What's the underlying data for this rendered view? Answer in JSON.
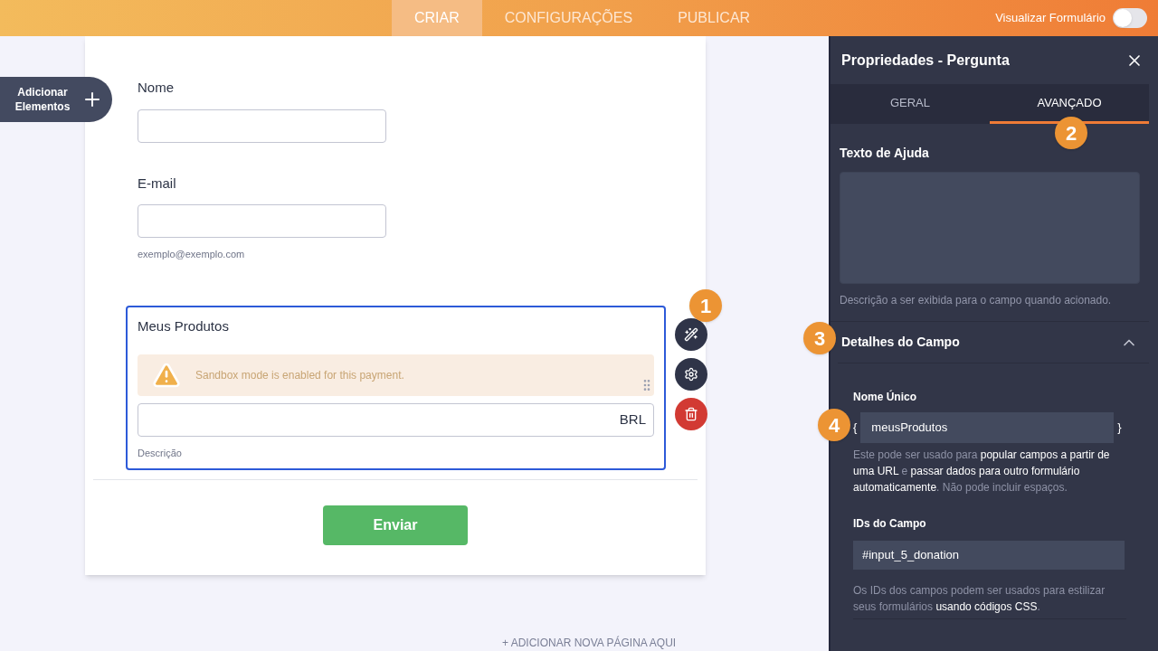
{
  "header": {
    "tabs": [
      {
        "label": "CRIAR",
        "selected": true
      },
      {
        "label": "CONFIGURAÇÕES",
        "selected": false
      },
      {
        "label": "PUBLICAR",
        "selected": false
      }
    ],
    "preview": {
      "label": "Visualizar Formulário",
      "on": false
    }
  },
  "add_elements": {
    "label": "Adicionar Elementos"
  },
  "form": {
    "fields": [
      {
        "kind": "text",
        "label": "Nome",
        "selected": false
      },
      {
        "kind": "email",
        "label": "E-mail",
        "hint": "exemplo@exemplo.com",
        "selected": false
      },
      {
        "kind": "payment",
        "label": "Meus Produtos",
        "warning": "Sandbox mode is enabled for this payment.",
        "currency": "BRL",
        "hint": "Descrição",
        "selected": true
      }
    ],
    "submit": "Enviar"
  },
  "add_page": "+ ADICIONAR NOVA PÁGINA AQUI",
  "panel": {
    "title": "Propriedades - Pergunta",
    "tabs": [
      {
        "label": "GERAL",
        "selected": false
      },
      {
        "label": "AVANÇADO",
        "selected": true
      }
    ],
    "help_text": {
      "label": "Texto de Ajuda",
      "note": "Descrição a ser exibida para o campo quando acionado."
    },
    "section": {
      "title": "Detalhes do Campo",
      "expanded": true,
      "unique_name": {
        "label": "Nome Único",
        "open_brace": "{",
        "value": "meusProdutos",
        "close_brace": "}",
        "note": "Este pode ser usado para **popular campos a partir de uma URL** e **passar dados para outro formulário automaticamente**. Não pode incluir espaços."
      },
      "field_ids": {
        "label": "IDs do Campo",
        "value": "#input_5_donation",
        "note": "Os IDs dos campos podem ser usados para estilizar seus formulários **usando códigos CSS**."
      }
    }
  },
  "callouts": [
    "1",
    "2",
    "3",
    "4"
  ]
}
